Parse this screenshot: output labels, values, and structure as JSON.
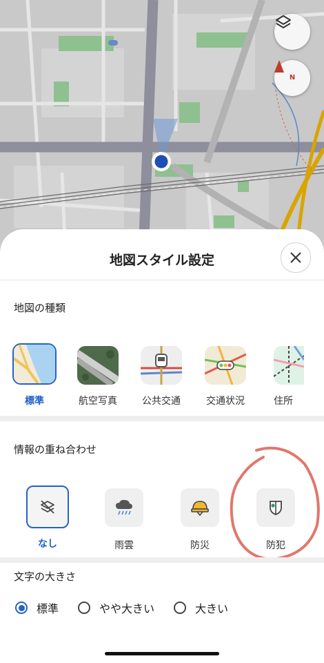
{
  "map": {
    "layers_button_icon": "layers-icon",
    "compass_label": "N",
    "location_marker": "current-location-dot"
  },
  "sheet": {
    "title": "地図スタイル設定",
    "close_icon": "close-icon",
    "map_type_section": {
      "label": "地図の種類",
      "items": [
        {
          "label": "標準",
          "selected": true
        },
        {
          "label": "航空写真",
          "selected": false
        },
        {
          "label": "公共交通",
          "selected": false
        },
        {
          "label": "交通状況",
          "selected": false
        },
        {
          "label": "住所",
          "selected": false
        }
      ]
    },
    "overlay_section": {
      "label": "情報の重ね合わせ",
      "items": [
        {
          "label": "なし",
          "icon": "layers-off-icon",
          "selected": true
        },
        {
          "label": "雨雲",
          "icon": "rain-cloud-icon",
          "selected": false
        },
        {
          "label": "防災",
          "icon": "helmet-icon",
          "selected": false
        },
        {
          "label": "防犯",
          "icon": "shield-icon",
          "selected": false
        }
      ]
    },
    "text_size_section": {
      "label": "文字の大きさ",
      "options": [
        {
          "label": "標準",
          "selected": true
        },
        {
          "label": "やや大きい",
          "selected": false
        },
        {
          "label": "大きい",
          "selected": false
        }
      ]
    }
  },
  "colors": {
    "accent": "#2563c4",
    "annotation": "#e0786c",
    "map_road": "#8e8e9c"
  }
}
